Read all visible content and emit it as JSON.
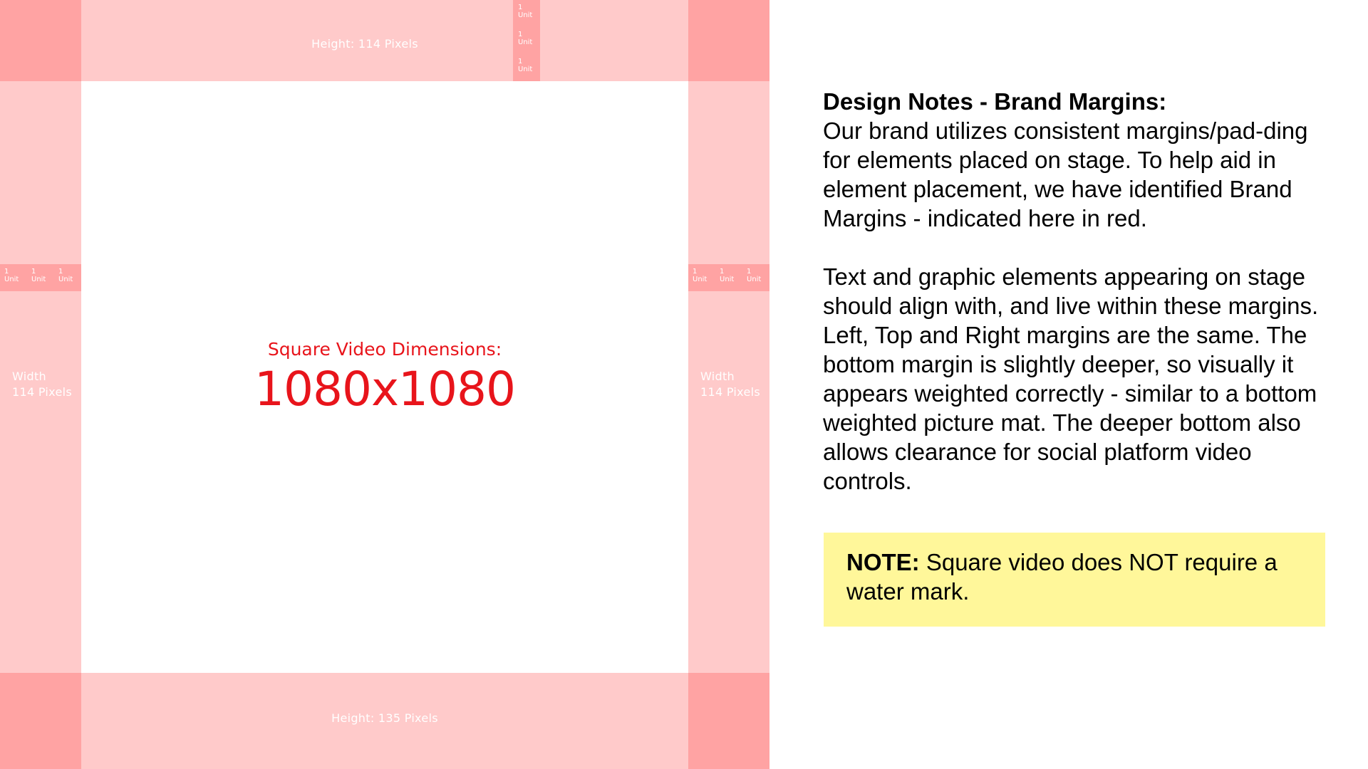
{
  "colors": {
    "margin_fill": "#FFCACA",
    "margin_corner_fill": "#FFA3A3",
    "accent_red": "#E8141B",
    "note_box_fill": "#FFF79A"
  },
  "stage": {
    "top_margin_label": "Height: 114 Pixels",
    "bottom_margin_label": "Height: 135 Pixels",
    "left_margin_label_line1": "Width",
    "left_margin_label_line2": "114 Pixels",
    "right_margin_label_line1": "Width",
    "right_margin_label_line2": "114 Pixels",
    "unit_number": "1",
    "unit_word": "Unit",
    "dimensions_caption": "Square Video Dimensions:",
    "dimensions_value": "1080x1080"
  },
  "notes": {
    "title": "Design Notes - Brand Margins:",
    "paragraph1": "Our brand utilizes consistent margins/pad-ding for elements placed on stage. To help aid in element placement, we have identified Brand Margins - indicated here in red.",
    "paragraph2": "Text and graphic elements appearing on stage should align with, and live within these margins. Left, Top and Right margins are the same. The bottom margin is slightly deeper, so visually it appears weighted correctly - similar to a bottom weighted picture mat. The deeper bottom also allows clearance for social platform video controls.",
    "note_label": "NOTE:",
    "note_text": " Square video does NOT require a water mark."
  }
}
